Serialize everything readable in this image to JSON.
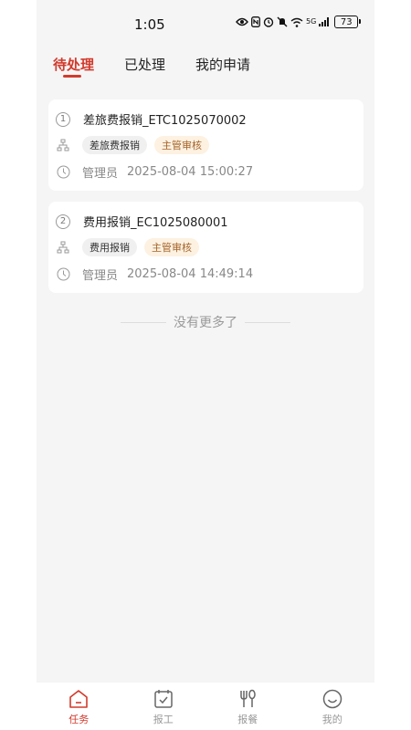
{
  "status_bar": {
    "time": "1:05",
    "network": "5G",
    "battery": "73"
  },
  "tabs": [
    {
      "label": "待处理",
      "active": true
    },
    {
      "label": "已处理",
      "active": false
    },
    {
      "label": "我的申请",
      "active": false
    }
  ],
  "tasks": [
    {
      "index": "1",
      "title": "差旅费报销_ETC1025070002",
      "tag_type": "差旅费报销",
      "tag_stage": "主管审核",
      "applicant": "管理员",
      "datetime": "2025-08-04 15:00:27"
    },
    {
      "index": "2",
      "title": "费用报销_EC1025080001",
      "tag_type": "费用报销",
      "tag_stage": "主管审核",
      "applicant": "管理员",
      "datetime": "2025-08-04 14:49:14"
    }
  ],
  "list_end_text": "没有更多了",
  "bottom_nav": [
    {
      "label": "任务",
      "icon": "home-icon",
      "active": true
    },
    {
      "label": "报工",
      "icon": "calendar-check-icon",
      "active": false
    },
    {
      "label": "报餐",
      "icon": "utensils-icon",
      "active": false
    },
    {
      "label": "我的",
      "icon": "smile-icon",
      "active": false
    }
  ],
  "colors": {
    "accent": "#d23a2c",
    "background": "#f5f5f5",
    "tag_orange_bg": "#fdf1e1",
    "tag_orange_text": "#a4642a"
  }
}
